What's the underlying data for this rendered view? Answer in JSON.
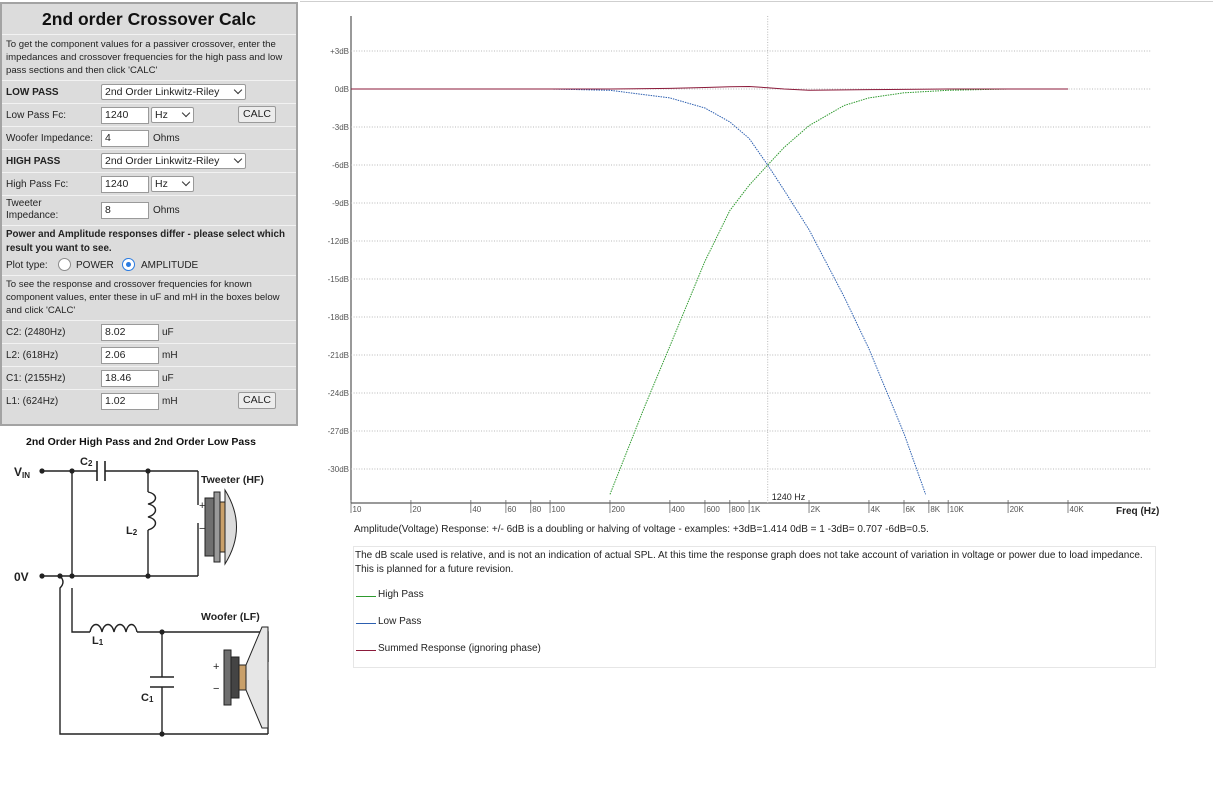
{
  "panel": {
    "title": "2nd order Crossover Calc",
    "intro": "To get the component values for a passiver crossover, enter the impedances and crossover frequencies for the high pass and low pass sections and then click 'CALC'",
    "low_pass": {
      "label": "LOW PASS",
      "filter": "2nd Order Linkwitz-Riley"
    },
    "low_pass_fc": {
      "label": "Low Pass Fc:",
      "value": "1240",
      "unit": "Hz"
    },
    "calc1": "CALC",
    "woofer": {
      "label": "Woofer Impedance:",
      "value": "4",
      "unit": "Ohms"
    },
    "high_pass": {
      "label": "HIGH PASS",
      "filter": "2nd Order Linkwitz-Riley"
    },
    "high_pass_fc": {
      "label": "High Pass Fc:",
      "value": "1240",
      "unit": "Hz"
    },
    "tweeter": {
      "label": "Tweeter Impedance:",
      "value": "8",
      "unit": "Ohms"
    },
    "warning": "Power and Amplitude responses differ - please select which result you want to see.",
    "plot_type": {
      "label": "Plot type:",
      "opt1": "POWER",
      "opt2": "AMPLITUDE",
      "selected": "AMPLITUDE"
    },
    "intro2": "To see the response and crossover frequencies for known component values, enter these in uF and mH in the boxes below and click 'CALC'",
    "components": [
      {
        "label": "C2: (2480Hz)",
        "value": "8.02",
        "unit": "uF"
      },
      {
        "label": "L2: (618Hz)",
        "value": "2.06",
        "unit": "mH"
      },
      {
        "label": "C1: (2155Hz)",
        "value": "18.46",
        "unit": "uF"
      },
      {
        "label": "L1: (624Hz)",
        "value": "1.02",
        "unit": "mH"
      }
    ],
    "calc2": "CALC"
  },
  "schematic": {
    "title": "2nd Order High Pass and 2nd Order Low Pass",
    "vin": "V",
    "vin_sub": "IN",
    "ov": "0V",
    "c2": "C",
    "c2_sub": "2",
    "l2": "L",
    "l2_sub": "2",
    "l1": "L",
    "l1_sub": "1",
    "c1": "C",
    "c1_sub": "1",
    "tweeter": "Tweeter (HF)",
    "woofer": "Woofer (LF)",
    "plus": "+",
    "minus": "−"
  },
  "graph": {
    "caption": "Amplitude(Voltage) Response: +/- 6dB is a doubling or halving of voltage - examples: +3dB=1.414  0dB = 1  -3dB= 0.707  -6dB=0.5.",
    "note": "The dB scale used is relative, and is not an indication of actual SPL. At this time the response graph does not take account of variation in voltage or power due to load impedance. This is planned for a future revision.",
    "legend": [
      {
        "name": "High Pass",
        "color": "#2e9a2e"
      },
      {
        "name": "Low Pass",
        "color": "#2c5fb0"
      },
      {
        "name": "Summed Response (ignoring phase)",
        "color": "#8b1a3a"
      }
    ]
  },
  "chart_data": {
    "type": "line",
    "xscale": "log",
    "xlabel": "Freq (Hz)",
    "xlim": [
      10,
      40000
    ],
    "ylim": [
      -33,
      3
    ],
    "yticks": [
      3,
      0,
      -3,
      -6,
      -9,
      -12,
      -15,
      -18,
      -21,
      -24,
      -27,
      -30
    ],
    "yticklabels": [
      "+3dB",
      "0dB",
      "-3dB",
      "-6dB",
      "-9dB",
      "-12dB",
      "-15dB",
      "-18dB",
      "-21dB",
      "-24dB",
      "-27dB",
      "-30dB"
    ],
    "xticks": [
      10,
      20,
      40,
      60,
      80,
      100,
      200,
      400,
      600,
      800,
      1000,
      2000,
      4000,
      6000,
      8000,
      10000,
      20000,
      40000
    ],
    "xticklabels": [
      "10",
      "20",
      "40",
      "60",
      "80",
      "100",
      "200",
      "400",
      "600",
      "800",
      "1K",
      "2K",
      "4K",
      "6K",
      "8K",
      "10K",
      "20K",
      "40K"
    ],
    "crossover_hz": 1240,
    "crossover_label": "1240 Hz",
    "grid": true,
    "series": [
      {
        "name": "High Pass",
        "color": "#2e9a2e",
        "x": [
          200,
          300,
          400,
          600,
          800,
          1000,
          1240,
          1500,
          2000,
          3000,
          4000,
          6000,
          10000,
          20000,
          40000
        ],
        "y": [
          -32,
          -25,
          -20.3,
          -13.6,
          -9.6,
          -7.6,
          -6,
          -4.6,
          -2.9,
          -1.3,
          -0.7,
          -0.3,
          -0.1,
          0,
          0
        ]
      },
      {
        "name": "Low Pass",
        "color": "#2c5fb0",
        "x": [
          10,
          100,
          200,
          400,
          600,
          800,
          1000,
          1240,
          1500,
          2000,
          3000,
          4000,
          6000,
          7700
        ],
        "y": [
          0,
          0,
          -0.1,
          -0.7,
          -1.5,
          -2.6,
          -3.9,
          -6,
          -8.0,
          -11.1,
          -16.4,
          -20.5,
          -27.2,
          -32
        ]
      },
      {
        "name": "Summed Response (ignoring phase)",
        "color": "#8b1a3a",
        "x": [
          10,
          100,
          200,
          400,
          600,
          800,
          1000,
          1240,
          1500,
          2000,
          4000,
          10000,
          40000
        ],
        "y": [
          0,
          0,
          0,
          0.05,
          0.12,
          0.18,
          0.2,
          0.1,
          0,
          -0.1,
          -0.05,
          0,
          0
        ]
      }
    ]
  }
}
